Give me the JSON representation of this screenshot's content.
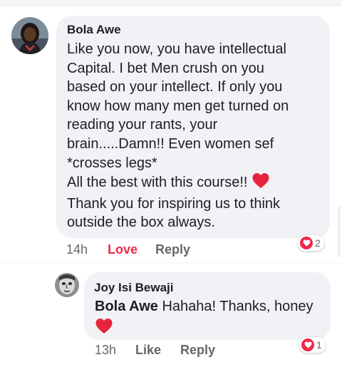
{
  "comments": [
    {
      "author": "Bola Awe",
      "text_lines": [
        "Like you now, you have intellectual",
        "Capital. I bet Men crush on you",
        "based on your intellect. If only you",
        "know how many men get turned on",
        "reading your rants, your",
        "brain.....Damn!! Even women sef",
        "*crosses legs*",
        "All the best with this course!!",
        "Thank you for inspiring us to think",
        "outside the box always."
      ],
      "time": "14h",
      "reaction_label": "Love",
      "reply_label": "Reply",
      "reaction_count": "2",
      "avatar_icon": "profile-photo-woman",
      "reaction_icon": "heart-icon",
      "love_color": "#f0284a"
    },
    {
      "author": "Joy Isi Bewaji",
      "mention": "Bola Awe",
      "text": "Hahaha! Thanks, honey",
      "time": "13h",
      "reaction_label": "Like",
      "reply_label": "Reply",
      "reaction_count": "1",
      "avatar_icon": "profile-photo-sketch",
      "reaction_icon": "heart-icon"
    }
  ]
}
